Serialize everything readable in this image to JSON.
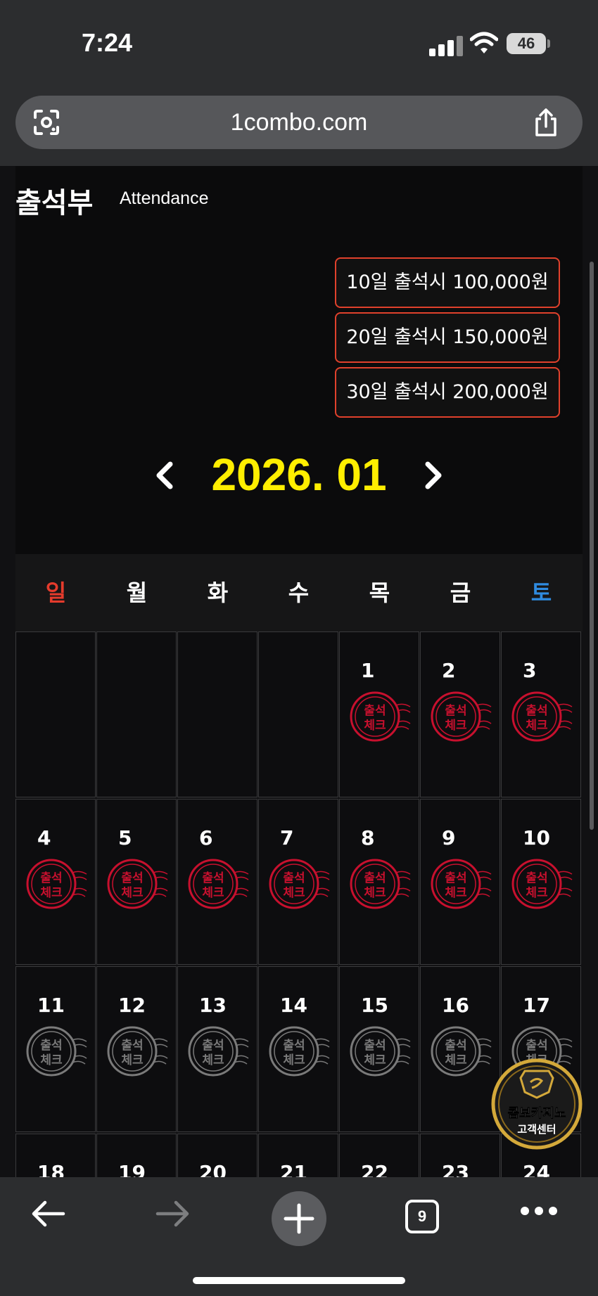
{
  "status_bar": {
    "time": "7:24",
    "battery": "46"
  },
  "browser": {
    "url": "1combo.com",
    "tab_count": "9"
  },
  "page": {
    "title": "출석부",
    "subtitle": "Attendance",
    "rewards": [
      "10일 출석시 100,000원",
      "20일 출석시 150,000원",
      "30일 출석시 200,000원"
    ],
    "month_label": "2026. 01",
    "weekdays": [
      "일",
      "월",
      "화",
      "수",
      "목",
      "금",
      "토"
    ],
    "weeks": [
      [
        null,
        null,
        null,
        null,
        {
          "day": "1",
          "checked": true
        },
        {
          "day": "2",
          "checked": true
        },
        {
          "day": "3",
          "checked": true
        }
      ],
      [
        {
          "day": "4",
          "checked": true
        },
        {
          "day": "5",
          "checked": true
        },
        {
          "day": "6",
          "checked": true
        },
        {
          "day": "7",
          "checked": true
        },
        {
          "day": "8",
          "checked": true
        },
        {
          "day": "9",
          "checked": true
        },
        {
          "day": "10",
          "checked": true
        }
      ],
      [
        {
          "day": "11",
          "checked": false
        },
        {
          "day": "12",
          "checked": false
        },
        {
          "day": "13",
          "checked": false
        },
        {
          "day": "14",
          "checked": false
        },
        {
          "day": "15",
          "checked": false
        },
        {
          "day": "16",
          "checked": false
        },
        {
          "day": "17",
          "checked": false
        }
      ],
      [
        {
          "day": "18",
          "checked": false
        },
        {
          "day": "19",
          "checked": false
        },
        {
          "day": "20",
          "checked": false
        },
        {
          "day": "21",
          "checked": false
        },
        {
          "day": "22",
          "checked": false
        },
        {
          "day": "23",
          "checked": false
        },
        {
          "day": "24",
          "checked": false
        }
      ]
    ],
    "stamp_text": [
      "출석",
      "체크"
    ],
    "support_badge": {
      "line1": "콤보카지노",
      "line2": "고객센터"
    }
  },
  "colors": {
    "accent_month": "#ffee00",
    "sunday": "#e53b2c",
    "saturday": "#2f8be0",
    "reward_border": "#e0412c",
    "stamp_active": "#c8102e",
    "stamp_inactive": "#7a7a7a"
  },
  "icons": {
    "lens": "google-lens-icon",
    "share": "share-icon",
    "prev": "chevron-left-icon",
    "next": "chevron-right-icon",
    "back": "arrow-left-icon",
    "forward": "arrow-right-icon",
    "new_tab": "plus-icon",
    "tabs": "tab-switcher-icon",
    "more": "more-dots-icon"
  }
}
